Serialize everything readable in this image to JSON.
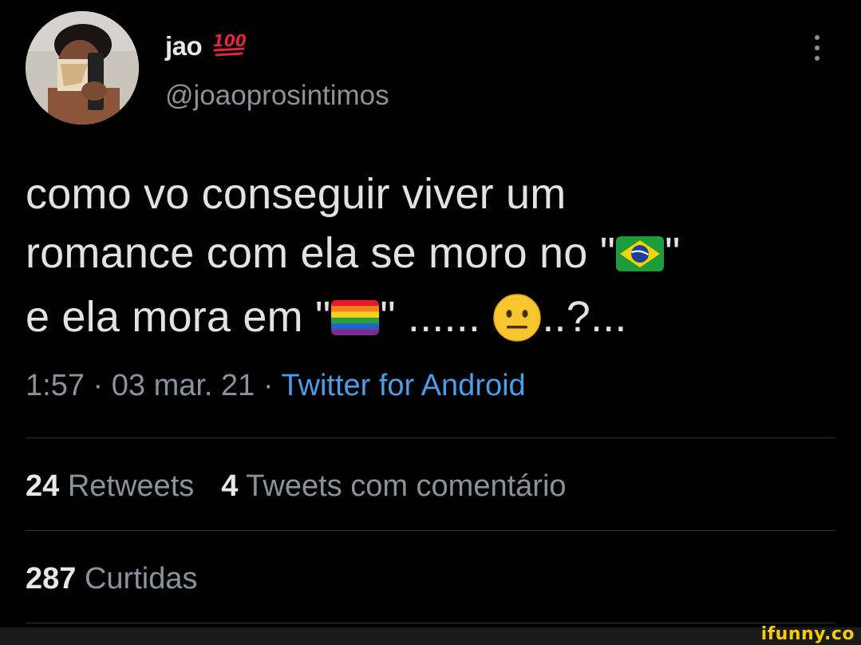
{
  "author": {
    "display_name": "jao",
    "name_emoji": "hundred-points-icon",
    "handle": "@joaoprosintimos"
  },
  "tweet": {
    "line1": "como vo conseguir viver um",
    "line2a": "romance com ela se moro no \"",
    "flag_br": "brazil-flag-icon",
    "line2b": "\"",
    "line3a": "e ela mora em \"",
    "flag_pride": "rainbow-flag-icon",
    "line3b": "\" ...... ",
    "face": "neutral-face-icon",
    "line3c": "..?..."
  },
  "meta": {
    "time": "1:57",
    "sep1": " · ",
    "date": "03 mar. 21",
    "sep2": " · ",
    "source": "Twitter for Android"
  },
  "stats": {
    "retweets_count": "24",
    "retweets_label": "Retweets",
    "quotes_count": "4",
    "quotes_label": "Tweets com comentário",
    "likes_count": "287",
    "likes_label": "Curtidas"
  },
  "watermark": "ifunny.co",
  "colors": {
    "background": "#000000",
    "text": "#e2e2e2",
    "secondary": "#8b9299",
    "link": "#4a9ee8",
    "divider": "#2f3336"
  }
}
